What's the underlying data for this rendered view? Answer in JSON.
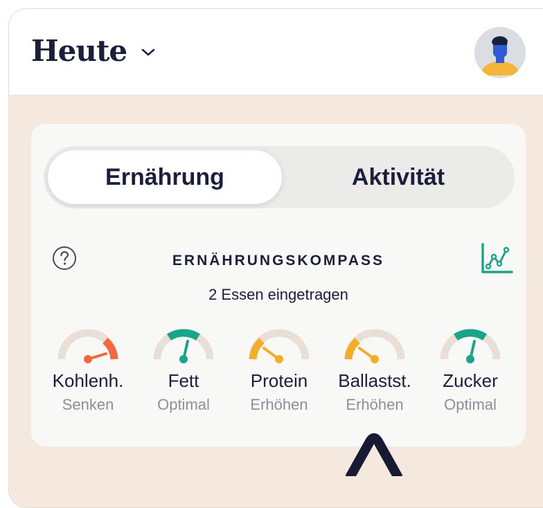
{
  "header": {
    "title": "Heute"
  },
  "tabs": [
    {
      "label": "Ernährung",
      "active": true
    },
    {
      "label": "Aktivität",
      "active": false
    }
  ],
  "compass": {
    "title": "ERNÄHRUNGSKOMPASS",
    "subtitle": "2 Essen eingetragen"
  },
  "gauges": [
    {
      "label": "Kohlenh.",
      "status": "Senken",
      "color": "#f06a3b"
    },
    {
      "label": "Fett",
      "status": "Optimal",
      "color": "#1aa58a"
    },
    {
      "label": "Protein",
      "status": "Erhöhen",
      "color": "#f2ad2a"
    },
    {
      "label": "Ballastst.",
      "status": "Erhöhen",
      "color": "#f2ad2a"
    },
    {
      "label": "Zucker",
      "status": "Optimal",
      "color": "#1aa58a"
    }
  ],
  "colors": {
    "accent_green": "#1aa58a",
    "text_dark": "#1b1f3b",
    "background_beige": "#f4e8df",
    "gauge_track": "#eadfd6"
  }
}
